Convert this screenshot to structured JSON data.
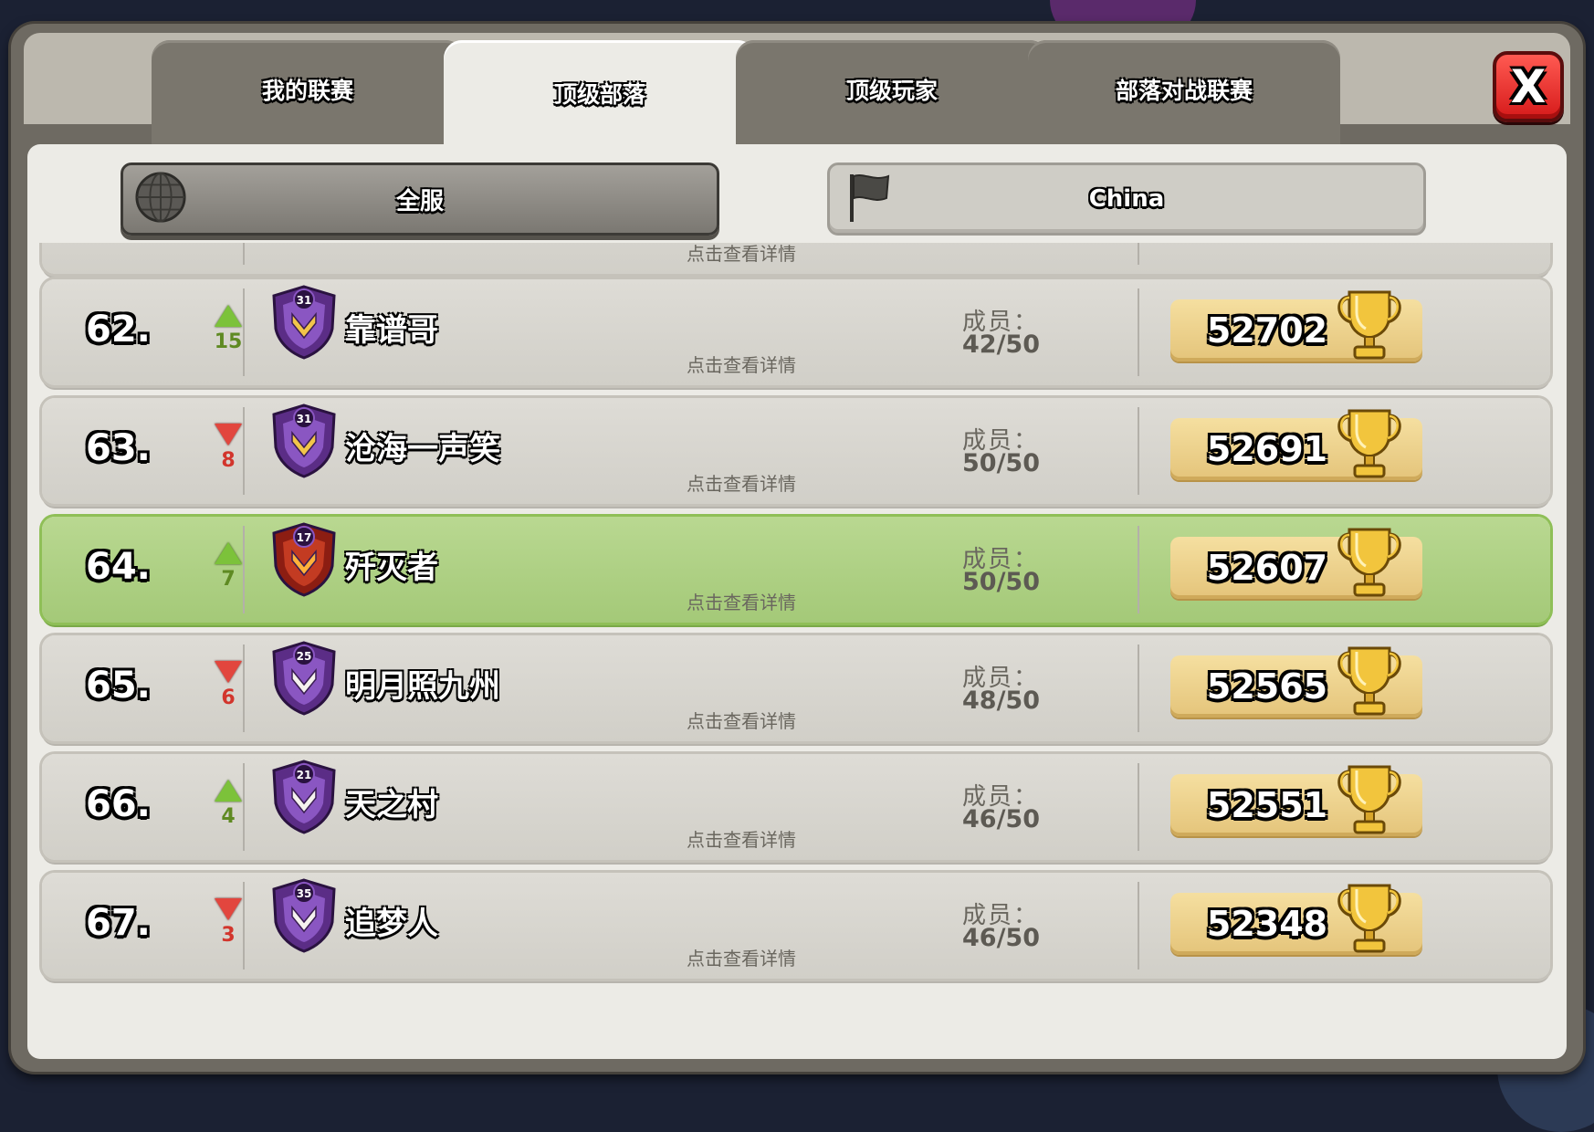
{
  "tabs": [
    {
      "label": "我的联赛",
      "active": false
    },
    {
      "label": "顶级部落",
      "active": true
    },
    {
      "label": "顶级玩家",
      "active": false
    },
    {
      "label": "部落对战联赛",
      "active": false
    }
  ],
  "close_label": "X",
  "filters": {
    "global_label": "全服",
    "country_label": "China"
  },
  "partial_top_row": {
    "detail": "点击查看详情"
  },
  "rows": [
    {
      "rank": "62.",
      "trend": "up",
      "change": "15",
      "badge_level": "31",
      "name": "靠谱哥",
      "detail": "点击查看详情",
      "members_label": "成员：",
      "members": "42/50",
      "trophies": "52702",
      "highlight": false
    },
    {
      "rank": "63.",
      "trend": "down",
      "change": "8",
      "badge_level": "31",
      "name": "沧海一声笑",
      "detail": "点击查看详情",
      "members_label": "成员：",
      "members": "50/50",
      "trophies": "52691",
      "highlight": false
    },
    {
      "rank": "64.",
      "trend": "up",
      "change": "7",
      "badge_level": "17",
      "name": "歼灭者",
      "detail": "点击查看详情",
      "members_label": "成员：",
      "members": "50/50",
      "trophies": "52607",
      "highlight": true
    },
    {
      "rank": "65.",
      "trend": "down",
      "change": "6",
      "badge_level": "25",
      "name": "明月照九州",
      "detail": "点击查看详情",
      "members_label": "成员：",
      "members": "48/50",
      "trophies": "52565",
      "highlight": false
    },
    {
      "rank": "66.",
      "trend": "up",
      "change": "4",
      "badge_level": "21",
      "name": "天之村",
      "detail": "点击查看详情",
      "members_label": "成员：",
      "members": "46/50",
      "trophies": "52551",
      "highlight": false
    },
    {
      "rank": "67.",
      "trend": "down",
      "change": "3",
      "badge_level": "35",
      "name": "追梦人",
      "detail": "点击查看详情",
      "members_label": "成员：",
      "members": "46/50",
      "trophies": "52348",
      "highlight": false
    }
  ],
  "colors": {
    "highlight_row": "#a9cc7e",
    "trend_up": "#7cc23a",
    "trend_down": "#e2463e",
    "trophy_box": "#ecd08a"
  }
}
